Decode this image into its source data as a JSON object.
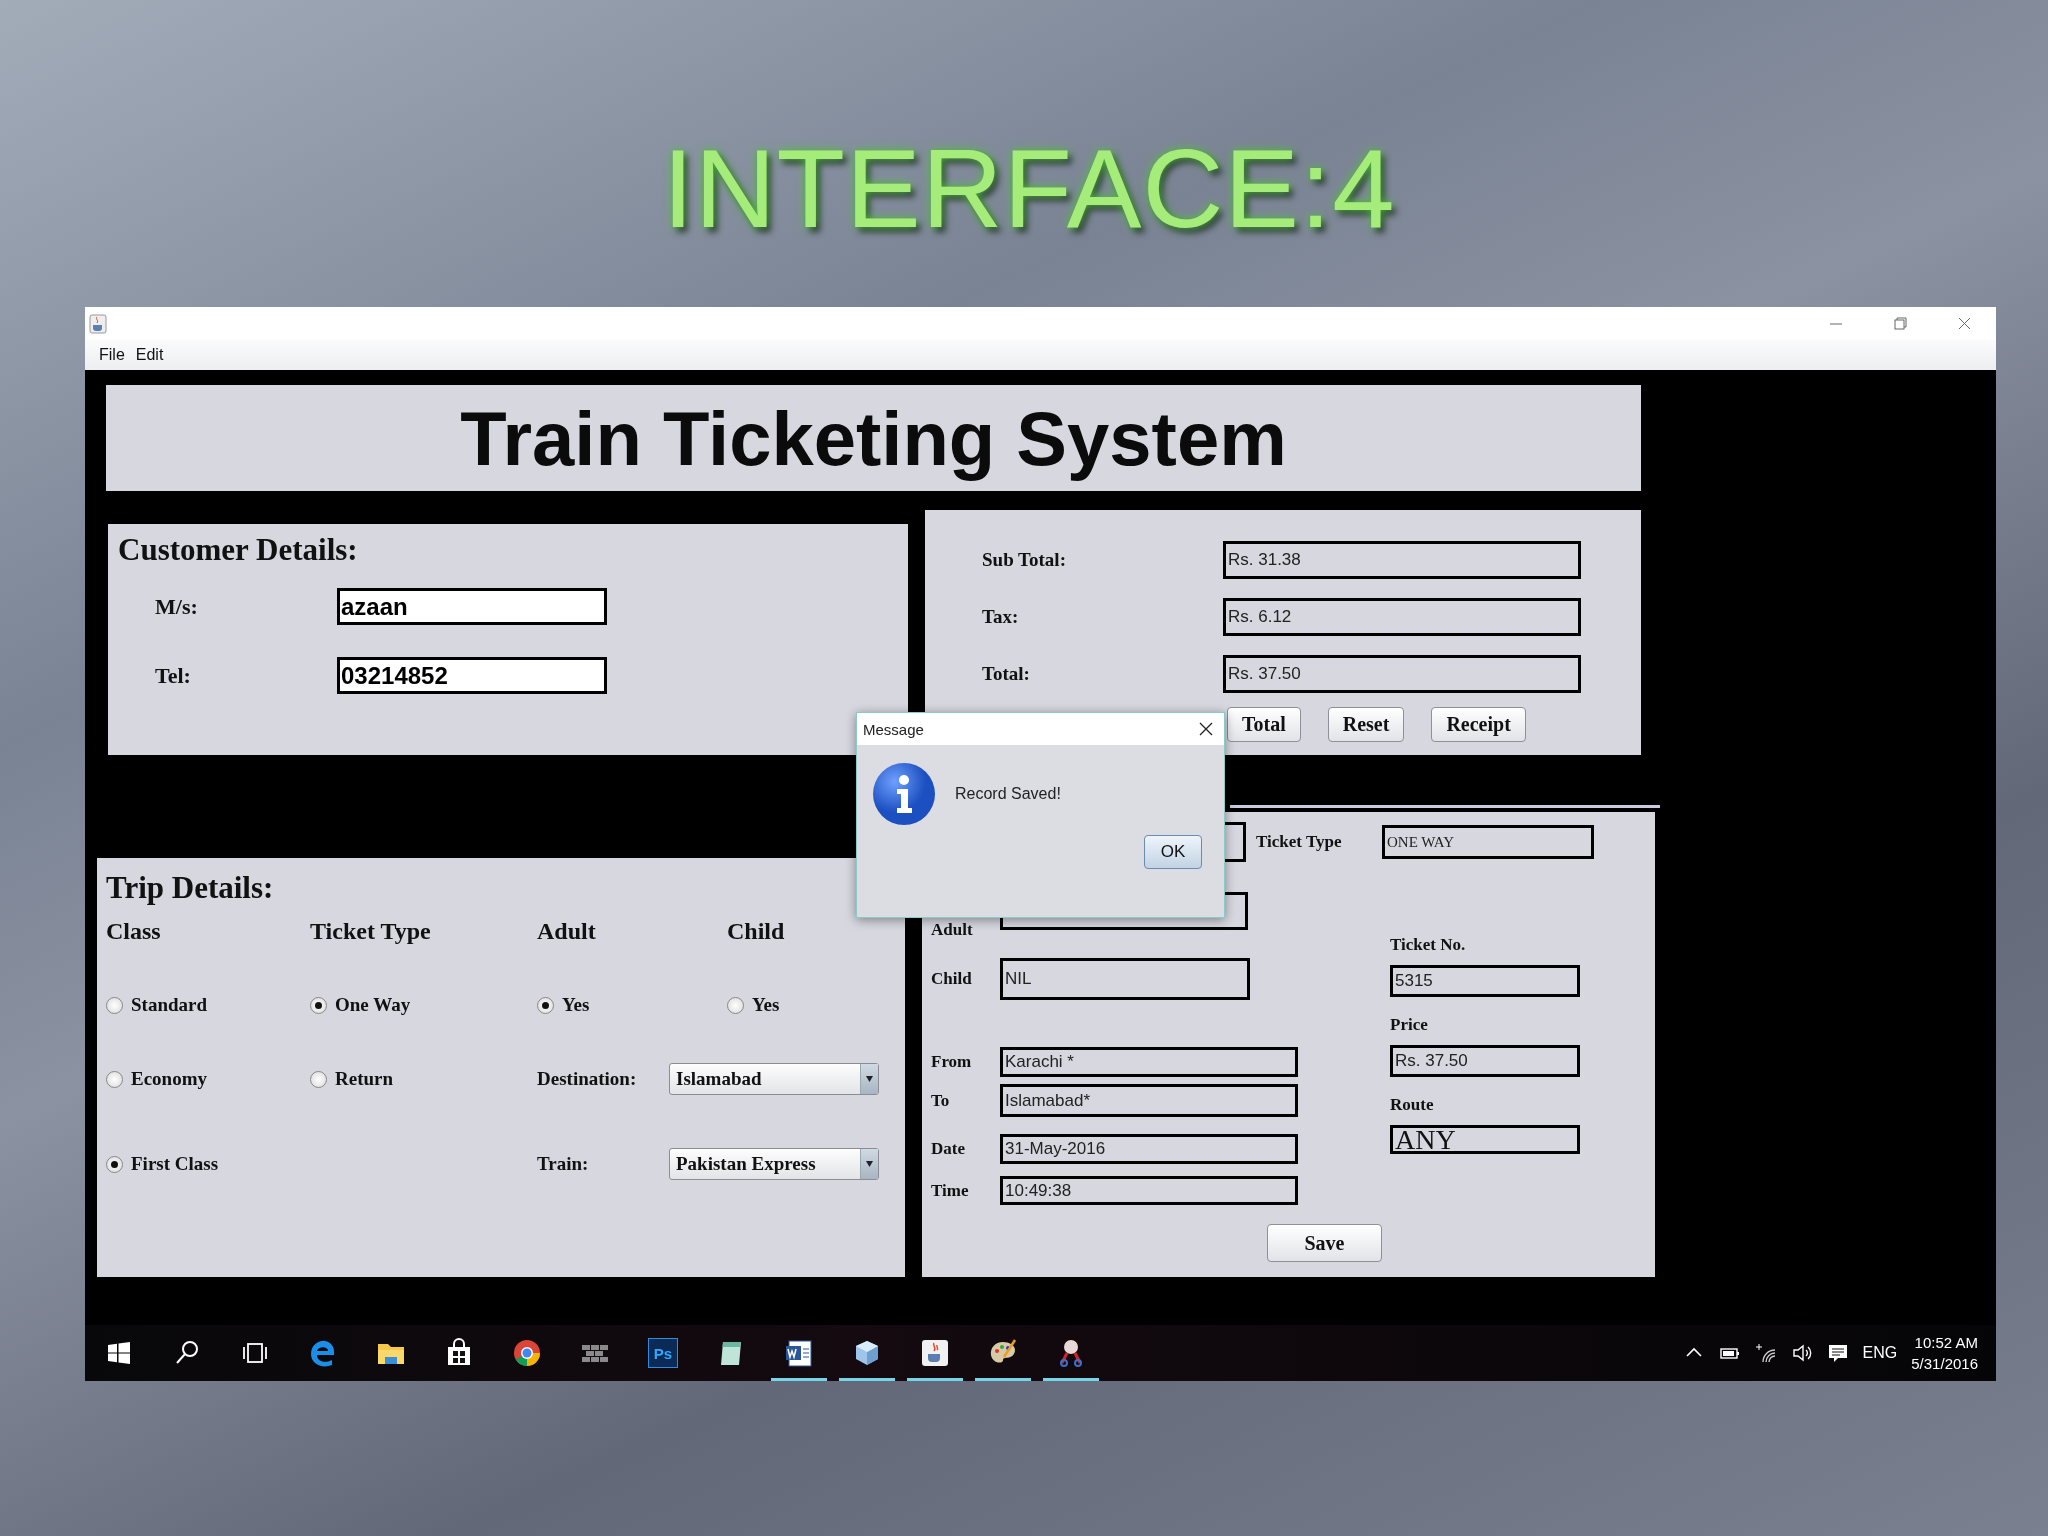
{
  "slide_title": "INTERFACE:4",
  "menu": [
    "File",
    "Edit"
  ],
  "app_title": "Train Ticketing System",
  "customer": {
    "heading": "Customer Details:",
    "fields": [
      {
        "label": "M/s:",
        "value": "azaan"
      },
      {
        "label": "Tel:",
        "value": "03214852"
      }
    ]
  },
  "totals": {
    "fields": [
      {
        "label": "Sub Total:",
        "value": "Rs. 31.38"
      },
      {
        "label": "Tax:",
        "value": "Rs. 6.12"
      },
      {
        "label": "Total:",
        "value": "Rs. 37.50"
      }
    ],
    "buttons": [
      "Total",
      "Reset",
      "Receipt"
    ]
  },
  "trip": {
    "heading": "Trip Details:",
    "columns": [
      "Class",
      "Ticket Type",
      "Adult",
      "Child"
    ],
    "class_options": [
      {
        "label": "Standard",
        "selected": false
      },
      {
        "label": "Economy",
        "selected": false
      },
      {
        "label": "First Class",
        "selected": true
      }
    ],
    "ticket_type_options": [
      {
        "label": "One Way",
        "selected": true
      },
      {
        "label": "Return",
        "selected": false
      }
    ],
    "adult_option": {
      "label": "Yes",
      "selected": true
    },
    "child_option": {
      "label": "Yes",
      "selected": false
    },
    "destination": {
      "label": "Destination:",
      "value": "Islamabad"
    },
    "train": {
      "label": "Train:",
      "value": "Pakistan Express"
    }
  },
  "ticket": {
    "ticket_type": {
      "label": "Ticket Type",
      "value": "ONE WAY"
    },
    "left_fields": [
      {
        "label": "Adult"
      },
      {
        "label": "Child",
        "value": "NIL"
      },
      {
        "label": "From",
        "value": "Karachi *"
      },
      {
        "label": "To",
        "value": "Islamabad*"
      },
      {
        "label": "Date",
        "value": "31-May-2016"
      },
      {
        "label": "Time",
        "value": "10:49:38"
      }
    ],
    "right_fields": [
      {
        "label": "Ticket No.",
        "value": "5315"
      },
      {
        "label": "Price",
        "value": "Rs. 37.50"
      },
      {
        "label": "Route",
        "value": "ANY",
        "kind": "large"
      }
    ],
    "save_button": "Save"
  },
  "dialog": {
    "title": "Message",
    "message": "Record Saved!",
    "button": "OK"
  },
  "taskbar": {
    "apps": [
      {
        "kind": "start",
        "running": false
      },
      {
        "kind": "search",
        "running": false
      },
      {
        "kind": "task-view",
        "running": false
      },
      {
        "kind": "edge",
        "running": false
      },
      {
        "kind": "folder",
        "running": false
      },
      {
        "kind": "store",
        "running": false
      },
      {
        "kind": "chrome",
        "running": false
      },
      {
        "kind": "wall",
        "running": false
      },
      {
        "kind": "photoshop",
        "label": "Ps",
        "running": false
      },
      {
        "kind": "notepad",
        "running": false
      },
      {
        "kind": "word",
        "running": true
      },
      {
        "kind": "cube",
        "running": true
      },
      {
        "kind": "java",
        "running": true
      },
      {
        "kind": "paint",
        "running": true
      },
      {
        "kind": "tool",
        "running": true
      }
    ],
    "language": "ENG",
    "time": "10:52 AM",
    "date": "5/31/2016"
  }
}
